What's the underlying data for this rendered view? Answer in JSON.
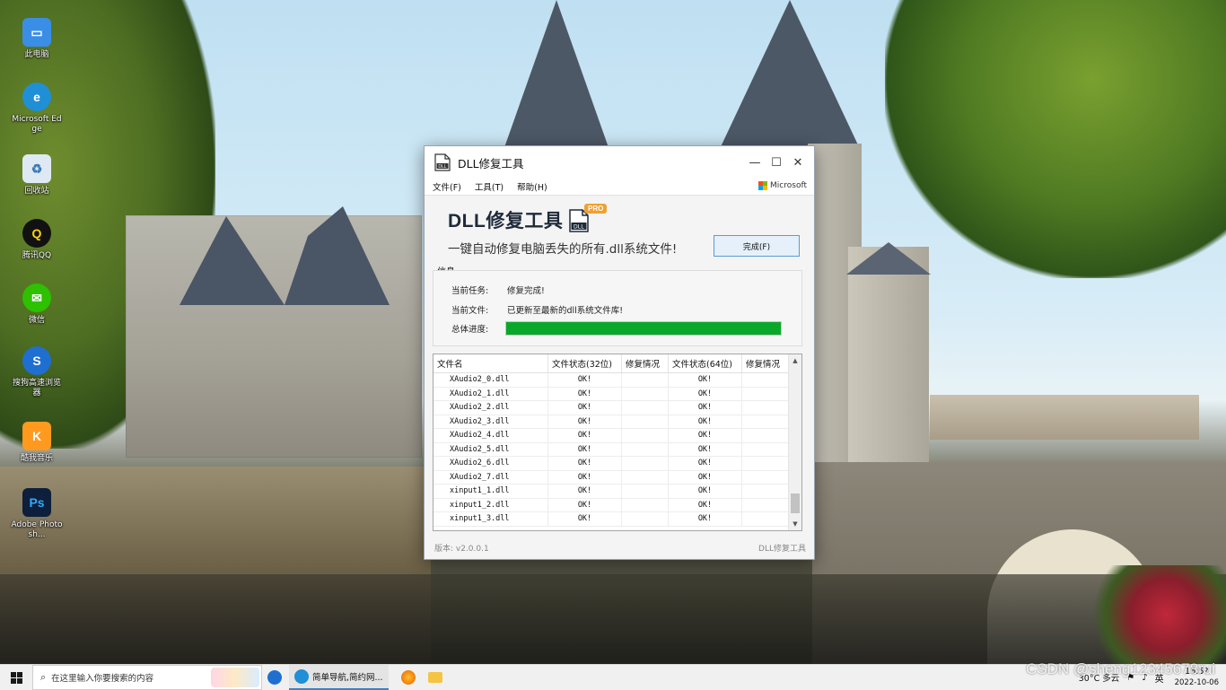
{
  "desktop": {
    "icons": [
      {
        "label": "此电脑",
        "icon": "computer-icon",
        "color": "#3a8ee6"
      },
      {
        "label": "Microsoft Edge",
        "icon": "edge-icon",
        "color": "#1f8fd6"
      },
      {
        "label": "回收站",
        "icon": "recycle-bin-icon",
        "color": "#6aa7d8"
      },
      {
        "label": "腾讯QQ",
        "icon": "qq-icon",
        "color": "#111111"
      },
      {
        "label": "微信",
        "icon": "wechat-icon",
        "color": "#2dc100"
      },
      {
        "label": "搜狗高速浏览器",
        "icon": "sogou-browser-icon",
        "color": "#1f6fd1"
      },
      {
        "label": "酷我音乐",
        "icon": "kuwo-music-icon",
        "color": "#ff9a1f"
      },
      {
        "label": "Adobe Photosh...",
        "icon": "photoshop-icon",
        "color": "#0d1f3a"
      }
    ]
  },
  "window": {
    "title": "DLL修复工具",
    "menu": [
      "文件(F)",
      "工具(T)",
      "帮助(H)"
    ],
    "brand_logo_text": "Microsoft",
    "hero_title": "DLL修复工具",
    "pro_badge": "PRO",
    "subtitle": "一键自动修复电脑丢失的所有.dll系统文件!",
    "finish_button": "完成(F)",
    "info": {
      "section_label": "信息",
      "current_task_label": "当前任务:",
      "current_task_value": "修复完成!",
      "current_file_label": "当前文件:",
      "current_file_value": "已更新至最新的dll系统文件库!",
      "progress_label": "总体进度:",
      "progress_percent": 100,
      "progress_color": "#0aa82a"
    },
    "table": {
      "columns": [
        "文件名",
        "文件状态(32位)",
        "修复情况",
        "文件状态(64位)",
        "修复情况"
      ],
      "rows": [
        [
          "XAudio2_0.dll",
          "OK!",
          "",
          "OK!",
          ""
        ],
        [
          "XAudio2_1.dll",
          "OK!",
          "",
          "OK!",
          ""
        ],
        [
          "XAudio2_2.dll",
          "OK!",
          "",
          "OK!",
          ""
        ],
        [
          "XAudio2_3.dll",
          "OK!",
          "",
          "OK!",
          ""
        ],
        [
          "XAudio2_4.dll",
          "OK!",
          "",
          "OK!",
          ""
        ],
        [
          "XAudio2_5.dll",
          "OK!",
          "",
          "OK!",
          ""
        ],
        [
          "XAudio2_6.dll",
          "OK!",
          "",
          "OK!",
          ""
        ],
        [
          "XAudio2_7.dll",
          "OK!",
          "",
          "OK!",
          ""
        ],
        [
          "xinput1_1.dll",
          "OK!",
          "",
          "OK!",
          ""
        ],
        [
          "xinput1_2.dll",
          "OK!",
          "",
          "OK!",
          ""
        ],
        [
          "xinput1_3.dll",
          "OK!",
          "",
          "OK!",
          ""
        ]
      ]
    },
    "version": "版本: v2.0.0.1",
    "footer_brand": "DLL修复工具"
  },
  "taskbar": {
    "search_placeholder": "在这里输入你要搜索的内容",
    "edge_label": "简单导航,简约网...",
    "weather": "30°C 多云",
    "clock_time": "16:5?",
    "clock_date": "2022-10-06",
    "ime": "英"
  },
  "watermark": "CSDN @sheng12345678rui"
}
